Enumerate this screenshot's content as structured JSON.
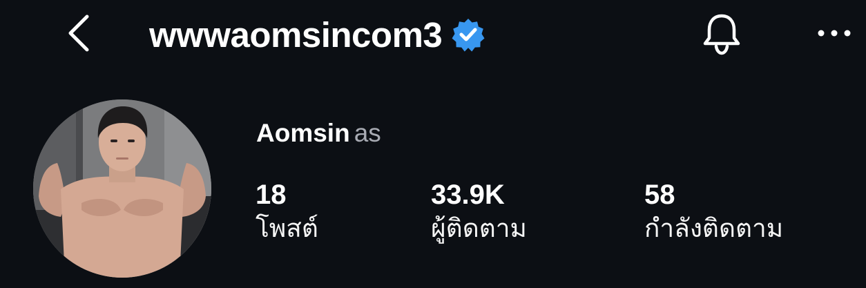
{
  "header": {
    "username": "wwwaomsincom3",
    "verified": true,
    "back_icon": "chevron-left-icon",
    "verified_icon": "verified-badge-icon",
    "bell_icon": "bell-icon",
    "more_icon": "more-horizontal-icon",
    "verified_color": "#3897f0"
  },
  "profile": {
    "display_name": "Aomsin",
    "pronouns": "as",
    "avatar_icon": "profile-photo"
  },
  "stats": [
    {
      "value": "18",
      "label": "โพสต์"
    },
    {
      "value": "33.9K",
      "label": "ผู้ติดตาม"
    },
    {
      "value": "58",
      "label": "กำลังติดตาม"
    }
  ],
  "colors": {
    "background": "#0c0f14",
    "text": "#ffffff",
    "secondary_text": "#a8abb3"
  }
}
